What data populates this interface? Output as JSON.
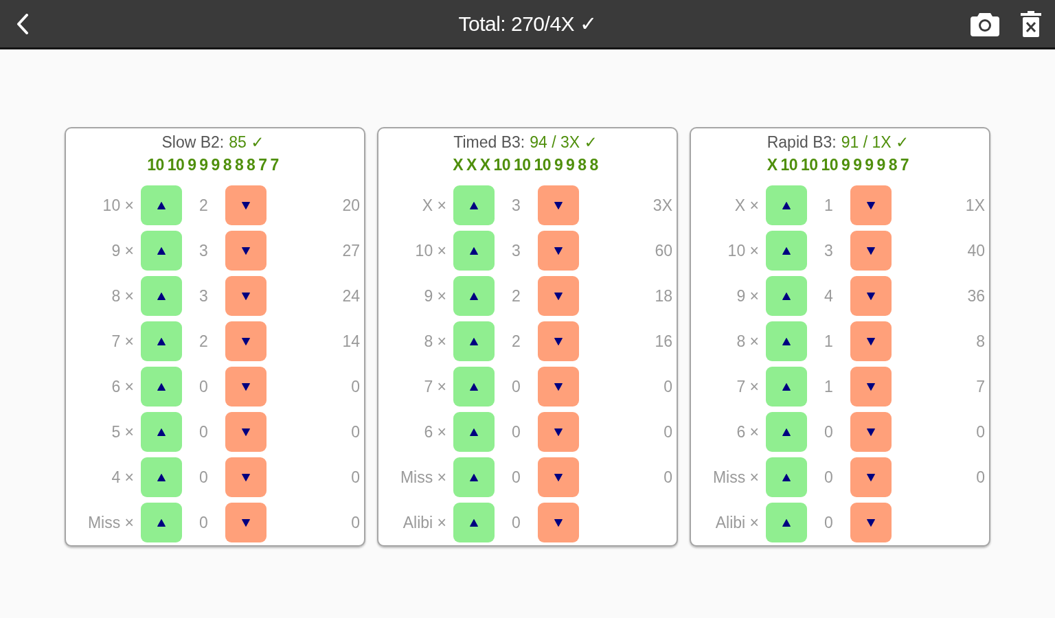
{
  "header": {
    "title": "Total: 270/4X ✓"
  },
  "cards": [
    {
      "name": "Slow B2:",
      "score": "85 ✓",
      "shots": "10 10 9 9 9 8 8 8 7 7",
      "rows": [
        {
          "label": "10 ×",
          "count": "2",
          "total": "20"
        },
        {
          "label": "9 ×",
          "count": "3",
          "total": "27"
        },
        {
          "label": "8 ×",
          "count": "3",
          "total": "24"
        },
        {
          "label": "7 ×",
          "count": "2",
          "total": "14"
        },
        {
          "label": "6 ×",
          "count": "0",
          "total": "0"
        },
        {
          "label": "5 ×",
          "count": "0",
          "total": "0"
        },
        {
          "label": "4 ×",
          "count": "0",
          "total": "0"
        },
        {
          "label": "Miss ×",
          "count": "0",
          "total": "0"
        }
      ]
    },
    {
      "name": "Timed B3:",
      "score": "94 / 3X ✓",
      "shots": "X X X 10 10 10 9 9 8 8",
      "rows": [
        {
          "label": "X ×",
          "count": "3",
          "total": "3X"
        },
        {
          "label": "10 ×",
          "count": "3",
          "total": "60"
        },
        {
          "label": "9 ×",
          "count": "2",
          "total": "18"
        },
        {
          "label": "8 ×",
          "count": "2",
          "total": "16"
        },
        {
          "label": "7 ×",
          "count": "0",
          "total": "0"
        },
        {
          "label": "6 ×",
          "count": "0",
          "total": "0"
        },
        {
          "label": "Miss ×",
          "count": "0",
          "total": "0"
        },
        {
          "label": "Alibi ×",
          "count": "0"
        }
      ]
    },
    {
      "name": "Rapid B3:",
      "score": "91 / 1X ✓",
      "shots": "X 10 10 10 9 9 9 9 8 7",
      "rows": [
        {
          "label": "X ×",
          "count": "1",
          "total": "1X"
        },
        {
          "label": "10 ×",
          "count": "3",
          "total": "40"
        },
        {
          "label": "9 ×",
          "count": "4",
          "total": "36"
        },
        {
          "label": "8 ×",
          "count": "1",
          "total": "8"
        },
        {
          "label": "7 ×",
          "count": "1",
          "total": "7"
        },
        {
          "label": "6 ×",
          "count": "0",
          "total": "0"
        },
        {
          "label": "Miss ×",
          "count": "0",
          "total": "0"
        },
        {
          "label": "Alibi ×",
          "count": "0"
        }
      ]
    }
  ]
}
